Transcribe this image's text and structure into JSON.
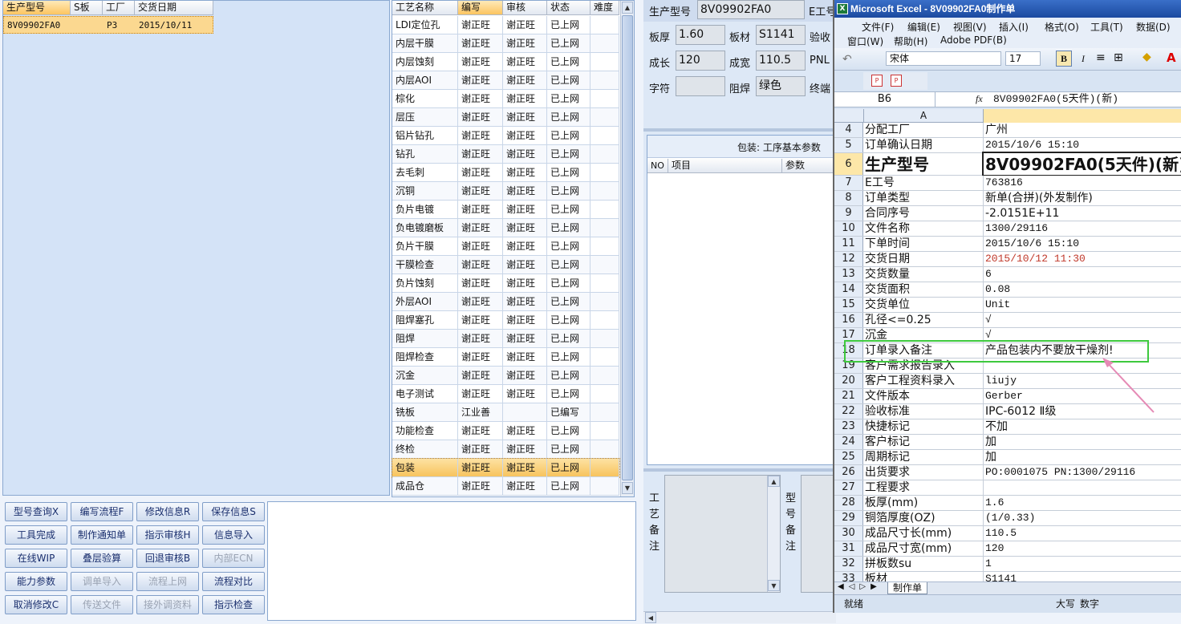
{
  "left_grid": {
    "headers": [
      "生产型号",
      "S板",
      "工厂",
      "交货日期"
    ],
    "row": {
      "model": "8V09902FA0",
      "factory": "P3",
      "date": "2015/10/11"
    }
  },
  "process_grid": {
    "headers": [
      "工艺名称",
      "编写",
      "审核",
      "状态",
      "难度"
    ],
    "rows": [
      {
        "name": "LDI定位孔",
        "writer": "谢正旺",
        "reviewer": "谢正旺",
        "status": "已上网"
      },
      {
        "name": "内层干膜",
        "writer": "谢正旺",
        "reviewer": "谢正旺",
        "status": "已上网"
      },
      {
        "name": "内层蚀刻",
        "writer": "谢正旺",
        "reviewer": "谢正旺",
        "status": "已上网"
      },
      {
        "name": "内层AOI",
        "writer": "谢正旺",
        "reviewer": "谢正旺",
        "status": "已上网"
      },
      {
        "name": "棕化",
        "writer": "谢正旺",
        "reviewer": "谢正旺",
        "status": "已上网"
      },
      {
        "name": "层压",
        "writer": "谢正旺",
        "reviewer": "谢正旺",
        "status": "已上网"
      },
      {
        "name": "铝片钻孔",
        "writer": "谢正旺",
        "reviewer": "谢正旺",
        "status": "已上网"
      },
      {
        "name": "钻孔",
        "writer": "谢正旺",
        "reviewer": "谢正旺",
        "status": "已上网"
      },
      {
        "name": "去毛刺",
        "writer": "谢正旺",
        "reviewer": "谢正旺",
        "status": "已上网"
      },
      {
        "name": "沉铜",
        "writer": "谢正旺",
        "reviewer": "谢正旺",
        "status": "已上网"
      },
      {
        "name": "负片电镀",
        "writer": "谢正旺",
        "reviewer": "谢正旺",
        "status": "已上网"
      },
      {
        "name": "负电镀磨板",
        "writer": "谢正旺",
        "reviewer": "谢正旺",
        "status": "已上网"
      },
      {
        "name": "负片干膜",
        "writer": "谢正旺",
        "reviewer": "谢正旺",
        "status": "已上网"
      },
      {
        "name": "干膜检查",
        "writer": "谢正旺",
        "reviewer": "谢正旺",
        "status": "已上网"
      },
      {
        "name": "负片蚀刻",
        "writer": "谢正旺",
        "reviewer": "谢正旺",
        "status": "已上网"
      },
      {
        "name": "外层AOI",
        "writer": "谢正旺",
        "reviewer": "谢正旺",
        "status": "已上网"
      },
      {
        "name": "阻焊塞孔",
        "writer": "谢正旺",
        "reviewer": "谢正旺",
        "status": "已上网"
      },
      {
        "name": "阻焊",
        "writer": "谢正旺",
        "reviewer": "谢正旺",
        "status": "已上网"
      },
      {
        "name": "阻焊检查",
        "writer": "谢正旺",
        "reviewer": "谢正旺",
        "status": "已上网"
      },
      {
        "name": "沉金",
        "writer": "谢正旺",
        "reviewer": "谢正旺",
        "status": "已上网"
      },
      {
        "name": "电子测试",
        "writer": "谢正旺",
        "reviewer": "谢正旺",
        "status": "已上网"
      },
      {
        "name": "铣板",
        "writer": "江业善",
        "reviewer": "",
        "status": "已编写"
      },
      {
        "name": "功能检查",
        "writer": "谢正旺",
        "reviewer": "谢正旺",
        "status": "已上网"
      },
      {
        "name": "终检",
        "writer": "谢正旺",
        "reviewer": "谢正旺",
        "status": "已上网"
      },
      {
        "name": "包装",
        "writer": "谢正旺",
        "reviewer": "谢正旺",
        "status": "已上网"
      },
      {
        "name": "成品仓",
        "writer": "谢正旺",
        "reviewer": "谢正旺",
        "status": "已上网"
      }
    ]
  },
  "buttons": [
    [
      "型号查询X",
      "编写流程F",
      "修改信息R",
      "保存信息S"
    ],
    [
      "工具完成",
      "制作通知单",
      "指示审核H",
      "信息导入"
    ],
    [
      "在线WIP",
      "叠层验算",
      "回退审核B",
      "内部ECN"
    ],
    [
      "能力参数",
      "调单导入",
      "流程上网",
      "流程对比"
    ],
    [
      "取消修改C",
      "传送文件",
      "接外调资料",
      "指示检查"
    ]
  ],
  "info": {
    "model_label": "生产型号",
    "model_value": "8V09902FA0",
    "e_label": "E工号",
    "thick_label": "板厚",
    "thick_value": "1.60",
    "mat_label": "板材",
    "mat_value": "S1141",
    "check_label": "验收",
    "len_label": "成长",
    "len_value": "120",
    "width_label": "成宽",
    "width_value": "110.5",
    "pnl_label": "PNL",
    "char_label": "字符",
    "char_value": "",
    "mask_label": "阻焊",
    "mask_value": "绿色",
    "end_label": "终端",
    "section_title": "包装: 工序基本参数",
    "col_no": "NO",
    "col_item": "项目",
    "col_param": "参数",
    "craft_note_label": "工艺备注",
    "model_note_label": "型号备注"
  },
  "excel": {
    "title": "Microsoft Excel - 8V09902FA0制作单",
    "menu1": [
      "文件(F)",
      "编辑(E)",
      "视图(V)",
      "插入(I)",
      "格式(O)",
      "工具(T)",
      "数据(D)"
    ],
    "menu2": [
      "窗口(W)",
      "帮助(H)",
      "Adobe PDF(B)"
    ],
    "font_name": "宋体",
    "font_size": "17",
    "name_box": "B6",
    "formula": "8V09902FA0(5天件)(新)",
    "col_a": "A",
    "rows": [
      {
        "n": "4",
        "a": "分配工厂",
        "b": "广州"
      },
      {
        "n": "5",
        "a": "订单确认日期",
        "b": "2015/10/6 15:10"
      },
      {
        "n": "6",
        "a": "生产型号",
        "b": "8V09902FA0(5天件)(新)"
      },
      {
        "n": "7",
        "a": "E工号",
        "b": "763816"
      },
      {
        "n": "8",
        "a": "订单类型",
        "b": "新单(合拼)(外发制作)"
      },
      {
        "n": "9",
        "a": "合同序号",
        "b": "-2.0151E+11"
      },
      {
        "n": "10",
        "a": "文件名称",
        "b": "1300/29116"
      },
      {
        "n": "11",
        "a": "下单时间",
        "b": "2015/10/6 15:10"
      },
      {
        "n": "12",
        "a": "交货日期",
        "b": "2015/10/12 11:30"
      },
      {
        "n": "13",
        "a": "交货数量",
        "b": "6"
      },
      {
        "n": "14",
        "a": "交货面积",
        "b": "0.08"
      },
      {
        "n": "15",
        "a": "交货单位",
        "b": "Unit"
      },
      {
        "n": "16",
        "a": "孔径<=0.25",
        "b": "√"
      },
      {
        "n": "17",
        "a": "沉金",
        "b": "√"
      },
      {
        "n": "18",
        "a": "订单录入备注",
        "b": "产品包装内不要放干燥剂!"
      },
      {
        "n": "19",
        "a": "客户需求报告录入",
        "b": ""
      },
      {
        "n": "20",
        "a": "客户工程资料录入",
        "b": "liujy"
      },
      {
        "n": "21",
        "a": "文件版本",
        "b": "Gerber"
      },
      {
        "n": "22",
        "a": "验收标准",
        "b": "IPC-6012 Ⅱ级"
      },
      {
        "n": "23",
        "a": "快捷标记",
        "b": "不加"
      },
      {
        "n": "24",
        "a": "客户标记",
        "b": "加"
      },
      {
        "n": "25",
        "a": "周期标记",
        "b": "加"
      },
      {
        "n": "26",
        "a": "出货要求",
        "b": "PO:0001075 PN:1300/29116"
      },
      {
        "n": "27",
        "a": "工程要求",
        "b": ""
      },
      {
        "n": "28",
        "a": "板厚(mm)",
        "b": "1.6"
      },
      {
        "n": "29",
        "a": "铜箔厚度(OZ)",
        "b": "(1/0.33)"
      },
      {
        "n": "30",
        "a": "成品尺寸长(mm)",
        "b": "110.5"
      },
      {
        "n": "31",
        "a": "成品尺寸宽(mm)",
        "b": "120"
      },
      {
        "n": "32",
        "a": "拼板数su",
        "b": "1"
      },
      {
        "n": "33",
        "a": "板材",
        "b": "S1141"
      }
    ],
    "sheet_tab": "制作单",
    "status": "就绪",
    "caps": "大写",
    "num": "数字",
    "accent_red": "#c0392b",
    "highlight_green": "#3ec93e"
  }
}
